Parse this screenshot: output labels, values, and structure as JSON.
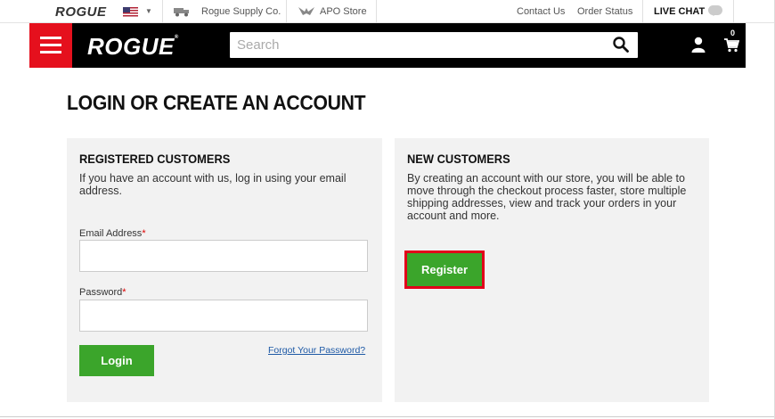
{
  "utility_bar": {
    "logo": "ROGUE",
    "supply_label": "Rogue Supply Co.",
    "apo_label": "APO Store",
    "contact_label": "Contact Us",
    "order_status_label": "Order Status",
    "live_chat_label": "LIVE CHAT"
  },
  "header": {
    "brand": "ROGUE",
    "brand_mark": "®",
    "search_placeholder": "Search",
    "search_value": "",
    "cart_count": "0"
  },
  "page": {
    "title": "LOGIN OR CREATE AN ACCOUNT"
  },
  "registered": {
    "heading": "REGISTERED CUSTOMERS",
    "description": "If you have an account with us, log in using your email address.",
    "email_label": "Email Address",
    "password_label": "Password",
    "required_mark": "*",
    "email_value": "",
    "password_value": "",
    "login_label": "Login",
    "forgot_label": "Forgot Your Password?"
  },
  "new_customers": {
    "heading": "NEW CUSTOMERS",
    "description": "By creating an account with our store, you will be able to move through the checkout process faster, store multiple shipping addresses, view and track your orders in your account and more.",
    "register_label": "Register"
  },
  "colors": {
    "accent_red": "#e5101d",
    "button_green": "#3ba52b",
    "link_blue": "#1f5aa6",
    "highlight_red": "#e2001a"
  },
  "icons": [
    "menu-icon",
    "us-flag-icon",
    "chevron-down-icon",
    "supply-truck-icon",
    "apo-eagle-icon",
    "chat-bubble-icon",
    "search-icon",
    "user-icon",
    "cart-icon"
  ]
}
